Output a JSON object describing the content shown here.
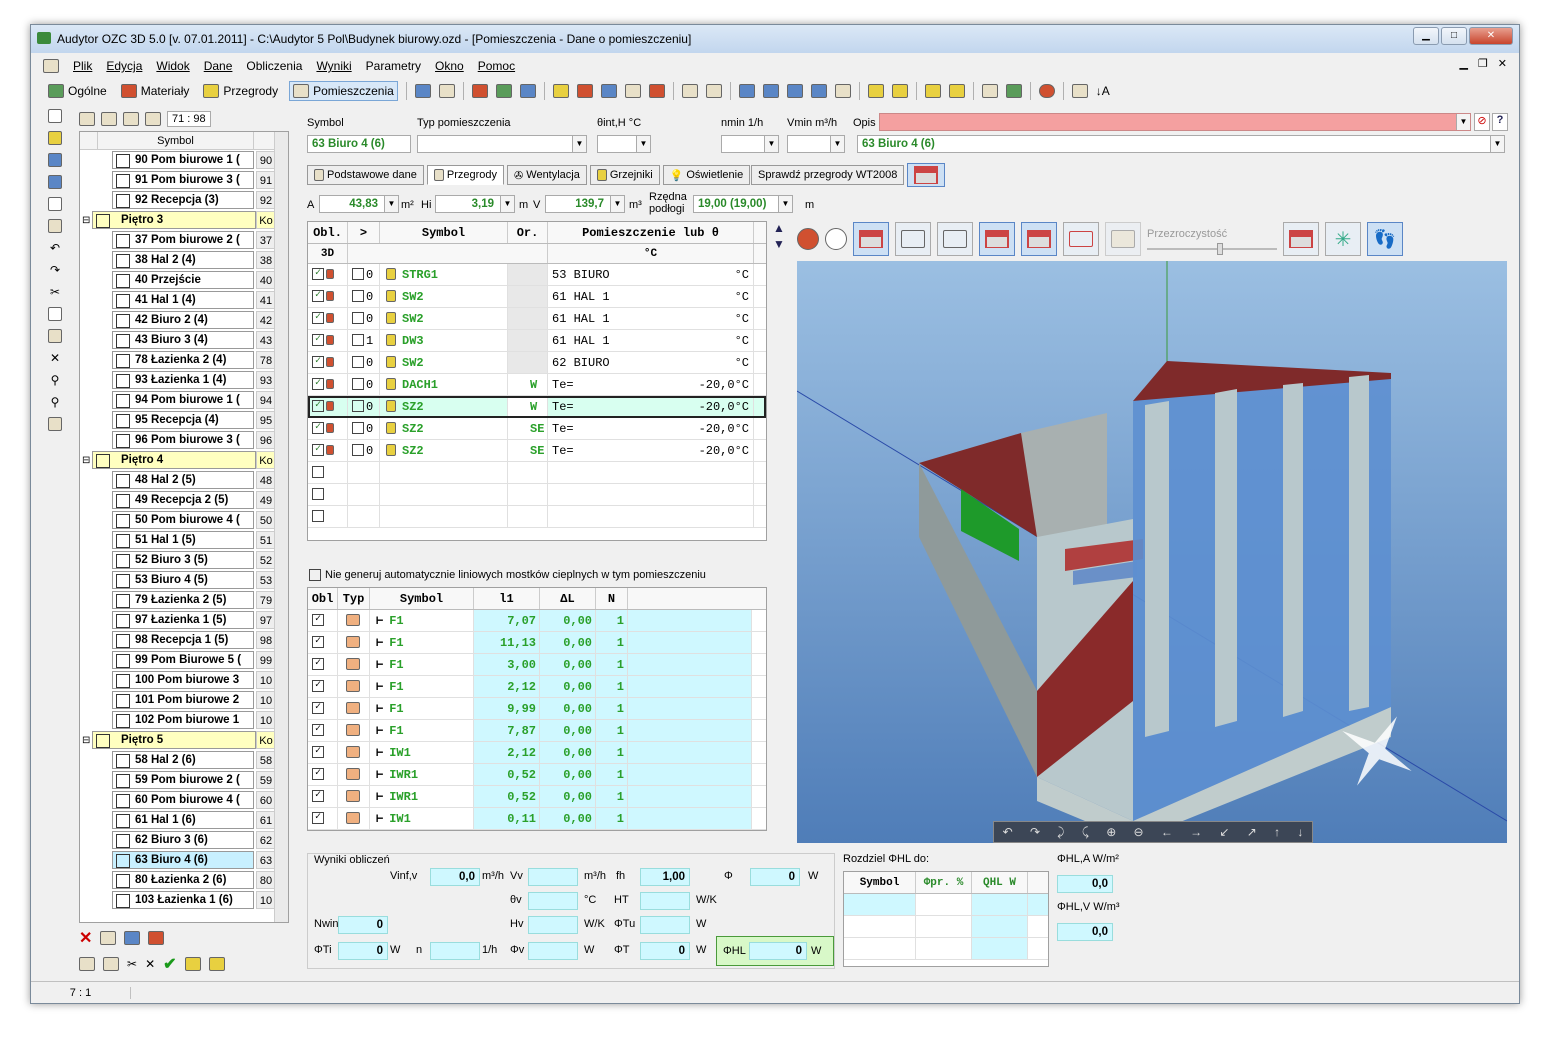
{
  "title": "Audytor OZC 3D 5.0  [v. 07.01.2011] - C:\\Audytor 5 Pol\\Budynek biurowy.ozd - [Pomieszczenia - Dane o pomieszczeniu]",
  "menu": [
    "Plik",
    "Edycja",
    "Widok",
    "Dane",
    "Obliczenia",
    "Wyniki",
    "Parametry",
    "Okno",
    "Pomoc"
  ],
  "toolbar": {
    "general": "Ogólne",
    "materials": "Materiały",
    "partitions": "Przegrody",
    "rooms": "Pomieszczenia"
  },
  "tree": {
    "ratio": "71 : 98",
    "header": "Symbol",
    "rows": [
      {
        "name": "90 Pom biurowe 1 (",
        "num": "90",
        "type": "room"
      },
      {
        "name": "91 Pom biurowe 3 (",
        "num": "91",
        "type": "room"
      },
      {
        "name": "92 Recepcja (3)",
        "num": "92",
        "type": "room"
      },
      {
        "name": "Piętro 3",
        "num": "Ko",
        "type": "floor"
      },
      {
        "name": "37 Pom biurowe 2 (",
        "num": "37",
        "type": "room"
      },
      {
        "name": "38 Hal 2 (4)",
        "num": "38",
        "type": "room"
      },
      {
        "name": "40 Przejście",
        "num": "40",
        "type": "room"
      },
      {
        "name": "41 Hal 1 (4)",
        "num": "41",
        "type": "room"
      },
      {
        "name": "42 Biuro 2 (4)",
        "num": "42",
        "type": "room"
      },
      {
        "name": "43 Biuro 3 (4)",
        "num": "43",
        "type": "room"
      },
      {
        "name": "78 Łazienka 2 (4)",
        "num": "78",
        "type": "room"
      },
      {
        "name": "93 Łazienka 1 (4)",
        "num": "93",
        "type": "room"
      },
      {
        "name": "94 Pom biurowe 1 (",
        "num": "94",
        "type": "room"
      },
      {
        "name": "95 Recepcja (4)",
        "num": "95",
        "type": "room"
      },
      {
        "name": "96 Pom biurowe 3 (",
        "num": "96",
        "type": "room"
      },
      {
        "name": "Piętro 4",
        "num": "Ko",
        "type": "floor"
      },
      {
        "name": "48 Hal 2 (5)",
        "num": "48",
        "type": "room"
      },
      {
        "name": "49 Recepcja 2 (5)",
        "num": "49",
        "type": "room"
      },
      {
        "name": "50 Pom biurowe 4 (",
        "num": "50",
        "type": "room"
      },
      {
        "name": "51 Hal 1 (5)",
        "num": "51",
        "type": "room"
      },
      {
        "name": "52 Biuro 3 (5)",
        "num": "52",
        "type": "room"
      },
      {
        "name": "53 Biuro 4 (5)",
        "num": "53",
        "type": "room"
      },
      {
        "name": "79 Łazienka 2 (5)",
        "num": "79",
        "type": "room"
      },
      {
        "name": "97 Łazienka 1 (5)",
        "num": "97",
        "type": "room"
      },
      {
        "name": "98 Recepcja 1 (5)",
        "num": "98",
        "type": "room"
      },
      {
        "name": "99 Pom Biurowe 5 (",
        "num": "99",
        "type": "room"
      },
      {
        "name": "100 Pom biurowe 3",
        "num": "10",
        "type": "room"
      },
      {
        "name": "101 Pom biurowe 2",
        "num": "10",
        "type": "room"
      },
      {
        "name": "102 Pom biurowe 1",
        "num": "10",
        "type": "room"
      },
      {
        "name": "Piętro 5",
        "num": "Ko",
        "type": "floor"
      },
      {
        "name": "58 Hal 2 (6)",
        "num": "58",
        "type": "room"
      },
      {
        "name": "59 Pom biurowe 2 (",
        "num": "59",
        "type": "room"
      },
      {
        "name": "60 Pom biurowe 4 (",
        "num": "60",
        "type": "room"
      },
      {
        "name": "61 Hal 1 (6)",
        "num": "61",
        "type": "room"
      },
      {
        "name": "62 Biuro 3 (6)",
        "num": "62",
        "type": "room"
      },
      {
        "name": "63 Biuro 4 (6)",
        "num": "63",
        "type": "sel"
      },
      {
        "name": "80 Łazienka 2 (6)",
        "num": "80",
        "type": "room"
      },
      {
        "name": "103 Łazienka 1 (6)",
        "num": "10",
        "type": "room"
      }
    ]
  },
  "form": {
    "symbol_lbl": "Symbol",
    "symbol": "63 Biuro 4 (6)",
    "type_lbl": "Typ pomieszczenia",
    "theta_lbl": "θint,H  °C",
    "nmin_lbl": "nmin  1/h",
    "vmin_lbl": "Vmin  m³/h",
    "desc_lbl": "Opis",
    "desc2": "63 Biuro 4 (6)",
    "a_lbl": "A",
    "a": "43,83",
    "a_unit": "m²",
    "h_lbl": "Hi",
    "h": "3,19",
    "h_unit": "m",
    "v_lbl": "V",
    "v": "139,7",
    "v_unit": "m³",
    "floor_lbl": "Rzędna podłogi",
    "floor": "19,00 (19,00)",
    "floor_unit": "m"
  },
  "tabs": [
    "Podstawowe dane",
    "Przegrody",
    "Wentylacja",
    "Grzejniki",
    "Oświetlenie"
  ],
  "check_btn": "Sprawdź przegrody WT2008",
  "walls": {
    "headers": [
      "Obl.",
      ">",
      "Symbol",
      "Or.",
      "Pomieszczenie lub θ"
    ],
    "subheaders": [
      "3D",
      "°C"
    ],
    "rows": [
      {
        "n": "0",
        "sym": "STRG1",
        "or": "",
        "room": "53  BIURO",
        "val": "°C"
      },
      {
        "n": "0",
        "sym": "SW2",
        "or": "",
        "room": "61  HAL  1",
        "val": "°C"
      },
      {
        "n": "0",
        "sym": "SW2",
        "or": "",
        "room": "61  HAL  1",
        "val": "°C"
      },
      {
        "n": "1",
        "sym": "DW3",
        "or": "",
        "room": "61  HAL  1",
        "val": "°C"
      },
      {
        "n": "0",
        "sym": "SW2",
        "or": "",
        "room": "62  BIURO",
        "val": "°C"
      },
      {
        "n": "0",
        "sym": "DACH1",
        "or": "W",
        "room": "Te=",
        "val": "-20,0°C"
      },
      {
        "n": "0",
        "sym": "SZ2",
        "or": "W",
        "room": "Te=",
        "val": "-20,0°C"
      },
      {
        "n": "0",
        "sym": "SZ2",
        "or": "SE",
        "room": "Te=",
        "val": "-20,0°C"
      },
      {
        "n": "0",
        "sym": "SZ2",
        "or": "SE",
        "room": "Te=",
        "val": "-20,0°C"
      }
    ]
  },
  "bridges_chk": "Nie generuj automatycznie liniowych mostków cieplnych w tym pomieszczeniu",
  "bridges": {
    "headers": [
      "Obl",
      "Typ",
      "Symbol",
      "l1",
      "ΔL",
      "N"
    ],
    "rows": [
      {
        "sym": "F1",
        "l": "7,07",
        "dl": "0,00",
        "n": "1"
      },
      {
        "sym": "F1",
        "l": "11,13",
        "dl": "0,00",
        "n": "1"
      },
      {
        "sym": "F1",
        "l": "3,00",
        "dl": "0,00",
        "n": "1"
      },
      {
        "sym": "F1",
        "l": "2,12",
        "dl": "0,00",
        "n": "1"
      },
      {
        "sym": "F1",
        "l": "9,99",
        "dl": "0,00",
        "n": "1"
      },
      {
        "sym": "F1",
        "l": "7,87",
        "dl": "0,00",
        "n": "1"
      },
      {
        "sym": "IW1",
        "l": "2,12",
        "dl": "0,00",
        "n": "1"
      },
      {
        "sym": "IWR1",
        "l": "0,52",
        "dl": "0,00",
        "n": "1"
      },
      {
        "sym": "IWR1",
        "l": "0,52",
        "dl": "0,00",
        "n": "1"
      },
      {
        "sym": "IW1",
        "l": "0,11",
        "dl": "0,00",
        "n": "1"
      }
    ]
  },
  "viewer": {
    "transparency": "Przezroczystość"
  },
  "results": {
    "title": "Wyniki obliczeń",
    "vinf_lbl": "Vinf,v",
    "vinf": "0,0",
    "vinf_u": "m³/h",
    "vv_lbl": "Vv",
    "vv_u": "m³/h",
    "fh_lbl": "fh",
    "fh": "1,00",
    "phi_lbl": "Φ",
    "phi": "0",
    "phi_u": "W",
    "tv_lbl": "θv",
    "tv_u": "°C",
    "ht_lbl": "HT",
    "ht_u": "W/K",
    "nwin_lbl": "Nwin",
    "nwin": "0",
    "hv_lbl": "Hv",
    "hv_u": "W/K",
    "ftu_lbl": "ΦTu",
    "ftu_u": "W",
    "fti_lbl": "ΦTi",
    "fti": "0",
    "fti_u": "W",
    "n_lbl": "n",
    "n_u": "1/h",
    "fv_lbl": "Φv",
    "fv_u": "W",
    "ft_lbl": "ΦT",
    "ft": "0",
    "ft_u": "W",
    "fhl_lbl": "ΦHL",
    "fhl": "0",
    "fhl_u": "W"
  },
  "split": {
    "title": "Rozdziel ΦHL do:",
    "h1": "Symbol",
    "h2": "Φpr. %",
    "h3": "QHL  W"
  },
  "phi_a": {
    "lbl": "ΦHL,A  W/m²",
    "val": "0,0"
  },
  "phi_v": {
    "lbl": "ΦHL,V  W/m³",
    "val": "0,0"
  },
  "status": "7 : 1"
}
